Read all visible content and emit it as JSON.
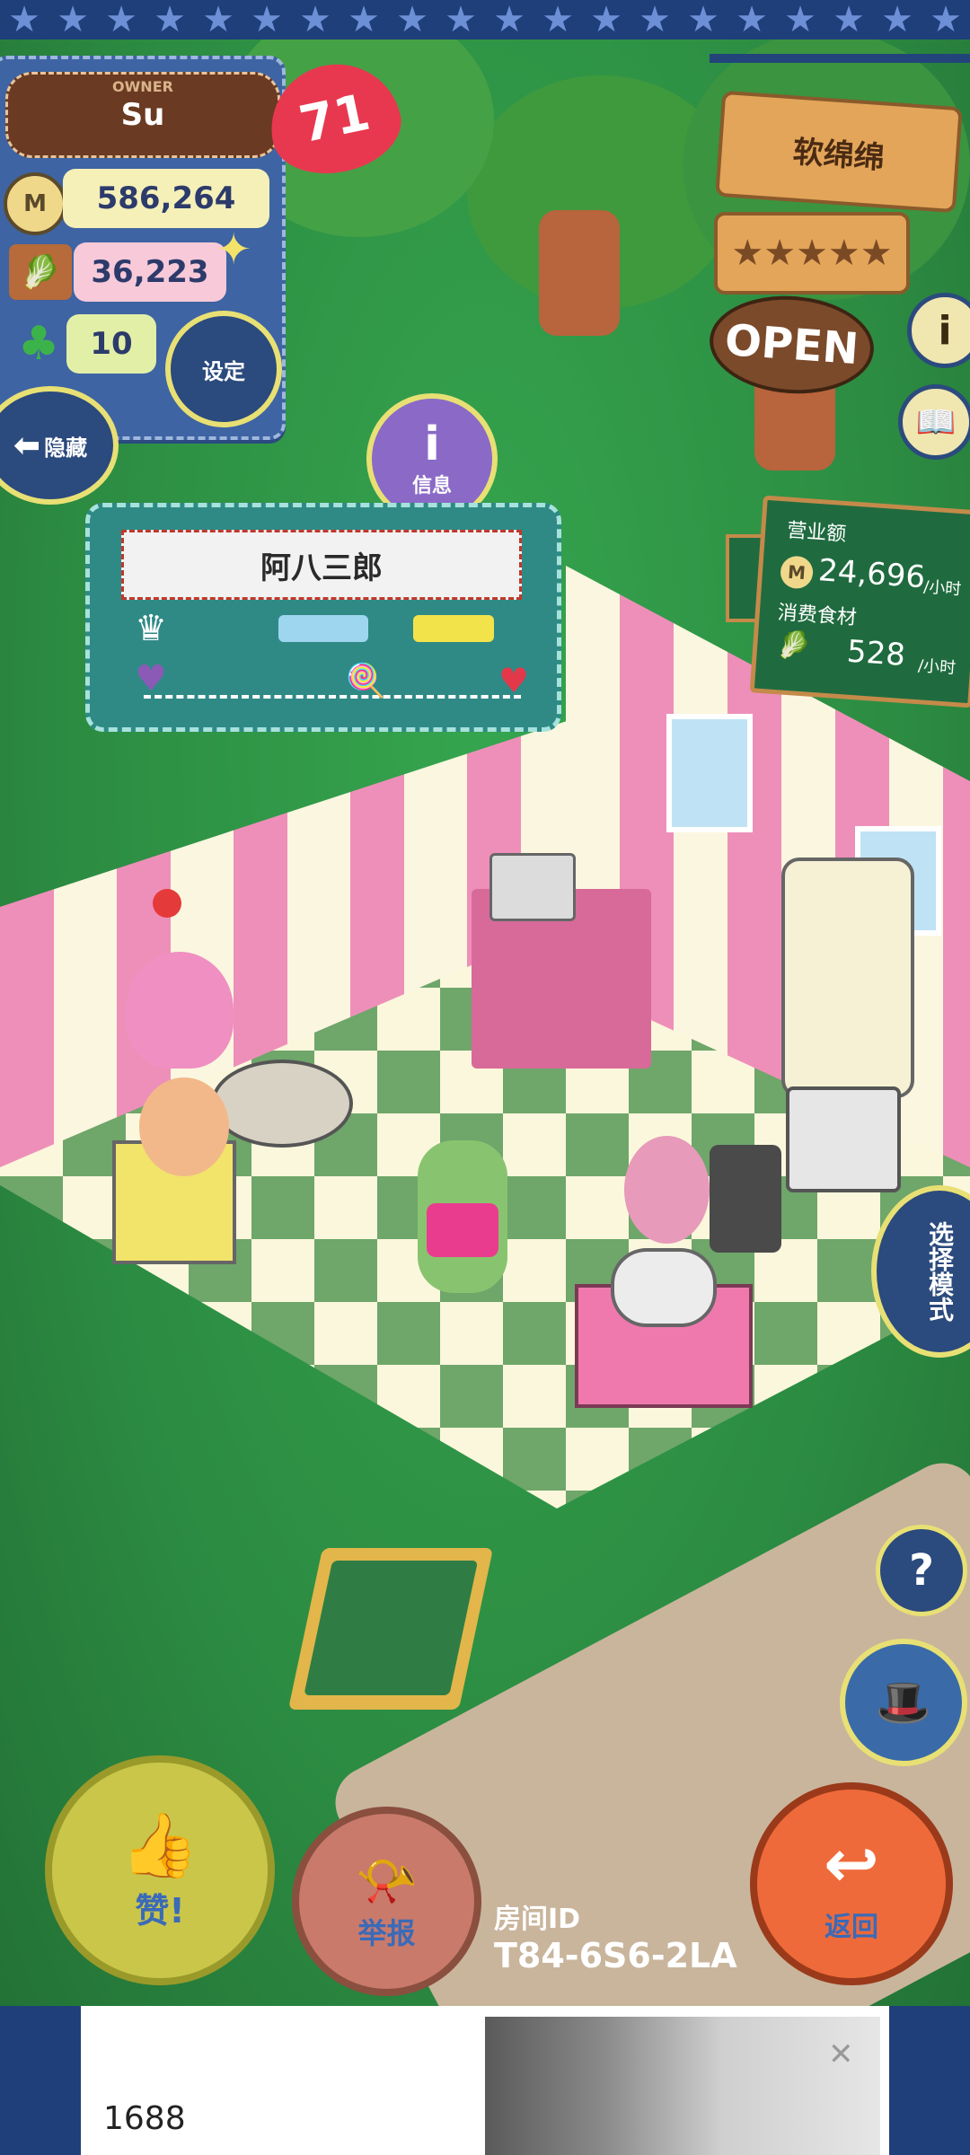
{
  "owner": {
    "label": "OWNER",
    "name": "Su",
    "hearts": "71",
    "coins": "586,264",
    "food": "36,223",
    "clover": "10",
    "settings_label": "设定",
    "hide_label": "隐藏"
  },
  "shop_sign": {
    "name": "软绵绵",
    "status": "OPEN"
  },
  "info_button_label": "信息",
  "character": {
    "name": "阿八三郎"
  },
  "stats_board": {
    "revenue_label": "营业额",
    "revenue_value": "24,696",
    "revenue_unit": "/小时",
    "food_label": "消费食材",
    "food_value": "528",
    "food_unit": "/小时"
  },
  "side_buttons": {
    "select_mode": "选择模式",
    "help": "?"
  },
  "bottom": {
    "like_label": "赞!",
    "report_label": "举报",
    "room_id_label": "房间ID",
    "room_id_value": "T84-6S6-2LA",
    "back_label": "返回"
  },
  "ad": {
    "text": "1688"
  },
  "colors": {
    "accent_yellow": "#e8e074",
    "denim": "#3e64a3",
    "grass": "#2f8f45",
    "back_button": "#ef6a3a"
  }
}
